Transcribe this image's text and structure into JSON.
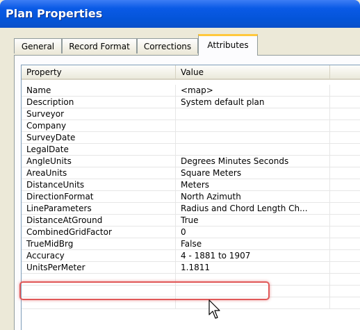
{
  "window": {
    "title": "Plan Properties"
  },
  "tabs": [
    {
      "label": "General"
    },
    {
      "label": "Record Format"
    },
    {
      "label": "Corrections"
    },
    {
      "label": "Attributes",
      "active": true
    }
  ],
  "grid": {
    "columns": [
      "Property",
      "Value"
    ],
    "rows": [
      {
        "property": "Name",
        "value": "<map>"
      },
      {
        "property": "Description",
        "value": "System default plan"
      },
      {
        "property": "Surveyor",
        "value": ""
      },
      {
        "property": "Company",
        "value": ""
      },
      {
        "property": "SurveyDate",
        "value": ""
      },
      {
        "property": "LegalDate",
        "value": ""
      },
      {
        "property": "AngleUnits",
        "value": "Degrees Minutes Seconds"
      },
      {
        "property": "AreaUnits",
        "value": "Square Meters"
      },
      {
        "property": "DistanceUnits",
        "value": "Meters"
      },
      {
        "property": "DirectionFormat",
        "value": "North Azimuth"
      },
      {
        "property": "LineParameters",
        "value": "Radius and Chord Length Ch..."
      },
      {
        "property": "DistanceAtGround",
        "value": "True"
      },
      {
        "property": "CombinedGridFactor",
        "value": "0"
      },
      {
        "property": "TrueMidBrg",
        "value": "False"
      },
      {
        "property": "Accuracy",
        "value": "4 - 1881 to 1907"
      },
      {
        "property": "UnitsPerMeter",
        "value": "1.1811"
      },
      {
        "property": "",
        "value": ""
      },
      {
        "property": "",
        "value": ""
      },
      {
        "property": "",
        "value": ""
      }
    ]
  },
  "colors": {
    "title_bar": "#0454d8",
    "active_tab_accent": "#ffc83c",
    "highlight_border": "#e05858"
  },
  "icons": {
    "cursor": "mouse-pointer-icon"
  }
}
